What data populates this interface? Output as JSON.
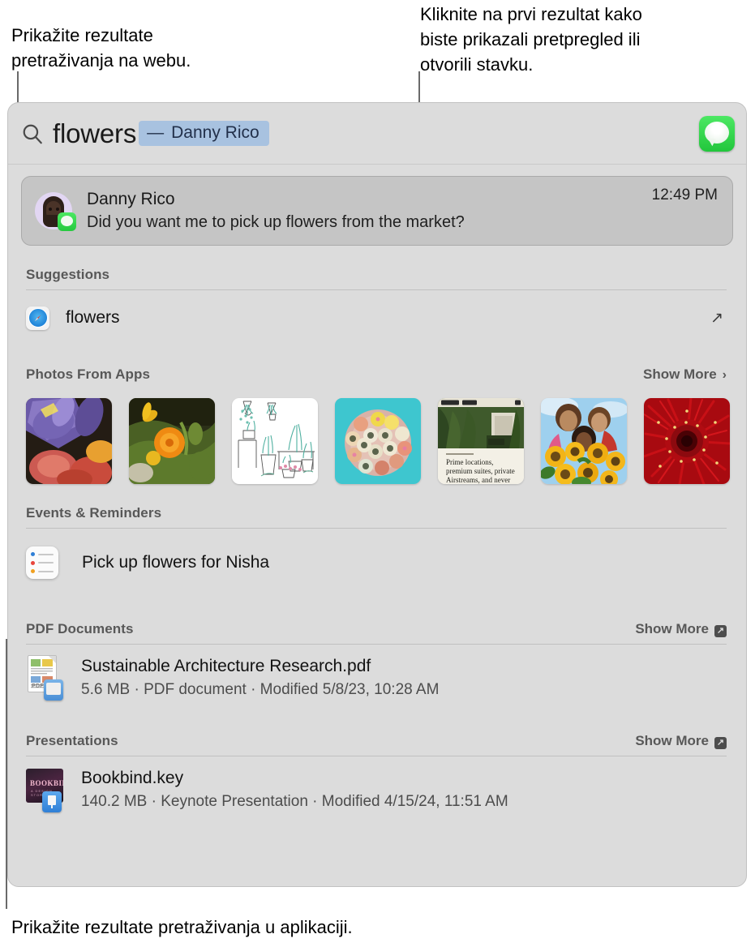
{
  "callouts": {
    "web_results": "Prikažite rezultate\npretraživanja na webu.",
    "click_first": "Kliknite na prvi rezultat kako\nbiste prikazali pretpregled ili\notvorili stavku.",
    "app_results": "Prikažite rezultate pretraživanja u aplikaciji."
  },
  "search": {
    "icon": "search-icon",
    "query": "flowers",
    "token_dash": "—",
    "token_label": "Danny Rico",
    "app_icon": "messages-app-icon"
  },
  "top_result": {
    "avatar": "memoji-avatar",
    "badge": "messages-badge-icon",
    "sender": "Danny Rico",
    "preview": "Did you want me to pick up flowers from the market?",
    "time": "12:49 PM"
  },
  "sections": [
    {
      "title": "Suggestions",
      "show_more": null,
      "show_more_icon": null
    },
    {
      "title": "Photos From Apps",
      "show_more": "Show More",
      "show_more_icon": "chevron-right-icon"
    },
    {
      "title": "Events & Reminders",
      "show_more": null,
      "show_more_icon": null
    },
    {
      "title": "PDF Documents",
      "show_more": "Show More",
      "show_more_icon": "open-external-icon"
    },
    {
      "title": "Presentations",
      "show_more": "Show More",
      "show_more_icon": "open-external-icon"
    }
  ],
  "suggestion": {
    "icon": "safari-icon",
    "label": "flowers",
    "action_icon": "arrow-up-right-icon"
  },
  "photos": [
    {
      "name": "purple-iris-flowers",
      "colors": [
        "#5b4a8e",
        "#8b7ec8",
        "#c85a4a",
        "#2a2218"
      ]
    },
    {
      "name": "orange-marigold-garden",
      "colors": [
        "#3d4a20",
        "#f08c18",
        "#6b8a32",
        "#1e2410"
      ]
    },
    {
      "name": "hanging-plants-illustration",
      "colors": [
        "#ffffff",
        "#6fb7a8",
        "#9fc9b4",
        "#d0d8c8"
      ]
    },
    {
      "name": "sushi-platter-teal",
      "colors": [
        "#3fc3cc",
        "#d8b0a8",
        "#e8c24a",
        "#8a5a48"
      ]
    },
    {
      "name": "airstream-listing-card",
      "colors": [
        "#f2efe4",
        "#4a6b3a",
        "#dcdcd0",
        "#2e4428"
      ]
    },
    {
      "name": "women-with-sunflowers",
      "colors": [
        "#8fc4e8",
        "#f0b81c",
        "#6b4a2a",
        "#c85a3a"
      ]
    },
    {
      "name": "red-gerbera-closeup",
      "colors": [
        "#c20f14",
        "#8a0a10",
        "#e8c85a",
        "#3a0205"
      ]
    }
  ],
  "reminder": {
    "icon": "reminders-icon",
    "label": "Pick up flowers for Nisha",
    "dot_colors": [
      "#2f7fd6",
      "#e8453c",
      "#f0a020"
    ]
  },
  "pdf_file": {
    "icon": "pdf-document-icon",
    "name": "Sustainable Architecture Research.pdf",
    "meta": "5.6 MB · PDF document · Modified 5/8/23, 10:28 AM",
    "badge_label": "PDF"
  },
  "presentation_file": {
    "icon": "keynote-document-icon",
    "name": "Bookbind.key",
    "meta": "140.2 MB · Keynote Presentation · Modified 4/15/24, 11:51 AM",
    "thumb_title": "BOOKBIND",
    "thumb_sub": "A DESIGN STORY"
  },
  "colors": {
    "panel_bg": "#dcdcdc",
    "card_bg": "#c5c5c5",
    "token_bg": "#a8c2e0",
    "section_text": "#585858",
    "accent_green": "#25c93f",
    "leader_line": "#6a6a6a"
  }
}
